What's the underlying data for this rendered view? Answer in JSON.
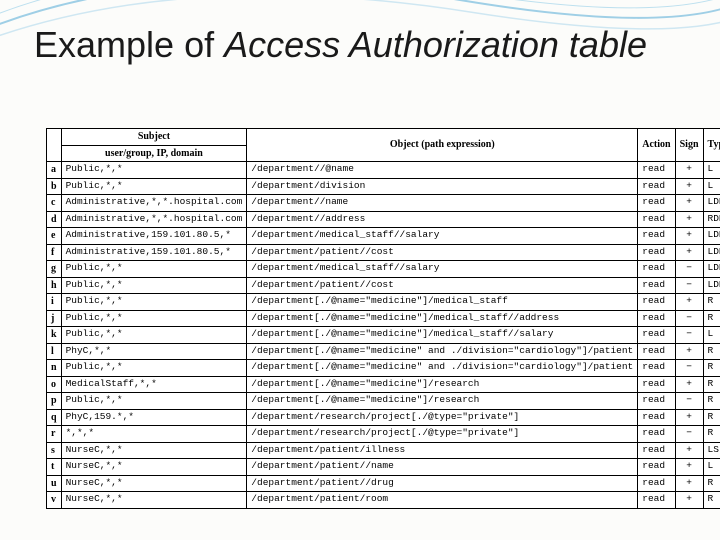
{
  "title_plain": "Example of ",
  "title_italic": "Access Authorization table",
  "headers": {
    "subject": "Subject",
    "subject_sub": "user/group, IP, domain",
    "object": "Object (path expression)",
    "action": "Action",
    "sign": "Sign",
    "type": "Type"
  },
  "rows": [
    {
      "id": "a",
      "subject": "Public,*,*",
      "object": "/department//@name",
      "action": "read",
      "sign": "+",
      "type": "L"
    },
    {
      "id": "b",
      "subject": "Public,*,*",
      "object": "/department/division",
      "action": "read",
      "sign": "+",
      "type": "L"
    },
    {
      "id": "c",
      "subject": "Administrative,*,*.hospital.com",
      "object": "/department//name",
      "action": "read",
      "sign": "+",
      "type": "LDH"
    },
    {
      "id": "d",
      "subject": "Administrative,*,*.hospital.com",
      "object": "/department//address",
      "action": "read",
      "sign": "+",
      "type": "RDH"
    },
    {
      "id": "e",
      "subject": "Administrative,159.101.80.5,*",
      "object": "/department/medical_staff//salary",
      "action": "read",
      "sign": "+",
      "type": "LDH"
    },
    {
      "id": "f",
      "subject": "Administrative,159.101.80.5,*",
      "object": "/department/patient//cost",
      "action": "read",
      "sign": "+",
      "type": "LDH"
    },
    {
      "id": "g",
      "subject": "Public,*,*",
      "object": "/department/medical_staff//salary",
      "action": "read",
      "sign": "−",
      "type": "LDH"
    },
    {
      "id": "h",
      "subject": "Public,*,*",
      "object": "/department/patient//cost",
      "action": "read",
      "sign": "−",
      "type": "LDH"
    },
    {
      "id": "i",
      "subject": "Public,*,*",
      "object": "/department[./@name=\"medicine\"]/medical_staff",
      "action": "read",
      "sign": "+",
      "type": "R"
    },
    {
      "id": "j",
      "subject": "Public,*,*",
      "object": "/department[./@name=\"medicine\"]/medical_staff//address",
      "action": "read",
      "sign": "−",
      "type": "R"
    },
    {
      "id": "k",
      "subject": "Public,*,*",
      "object": "/department[./@name=\"medicine\"]/medical_staff//salary",
      "action": "read",
      "sign": "−",
      "type": "L"
    },
    {
      "id": "l",
      "subject": "PhyC,*,*",
      "object": "/department[./@name=\"medicine\" and ./division=\"cardiology\"]/patient",
      "action": "read",
      "sign": "+",
      "type": "R"
    },
    {
      "id": "n",
      "subject": "Public,*,*",
      "object": "/department[./@name=\"medicine\" and ./division=\"cardiology\"]/patient",
      "action": "read",
      "sign": "−",
      "type": "R"
    },
    {
      "id": "o",
      "subject": "MedicalStaff,*,*",
      "object": "/department[./@name=\"medicine\"]/research",
      "action": "read",
      "sign": "+",
      "type": "R"
    },
    {
      "id": "p",
      "subject": "Public,*,*",
      "object": "/department[./@name=\"medicine\"]/research",
      "action": "read",
      "sign": "−",
      "type": "R"
    },
    {
      "id": "q",
      "subject": "PhyC,159.*,*",
      "object": "/department/research/project[./@type=\"private\"]",
      "action": "read",
      "sign": "+",
      "type": "R"
    },
    {
      "id": "r",
      "subject": "*,*,*",
      "object": "/department/research/project[./@type=\"private\"]",
      "action": "read",
      "sign": "−",
      "type": "R"
    },
    {
      "id": "s",
      "subject": "NurseC,*,*",
      "object": "/department/patient/illness",
      "action": "read",
      "sign": "+",
      "type": "LS"
    },
    {
      "id": "t",
      "subject": "NurseC,*,*",
      "object": "/department/patient//name",
      "action": "read",
      "sign": "+",
      "type": "L"
    },
    {
      "id": "u",
      "subject": "NurseC,*,*",
      "object": "/department/patient//drug",
      "action": "read",
      "sign": "+",
      "type": "R"
    },
    {
      "id": "v",
      "subject": "NurseC,*,*",
      "object": "/department/patient/room",
      "action": "read",
      "sign": "+",
      "type": "R"
    }
  ]
}
